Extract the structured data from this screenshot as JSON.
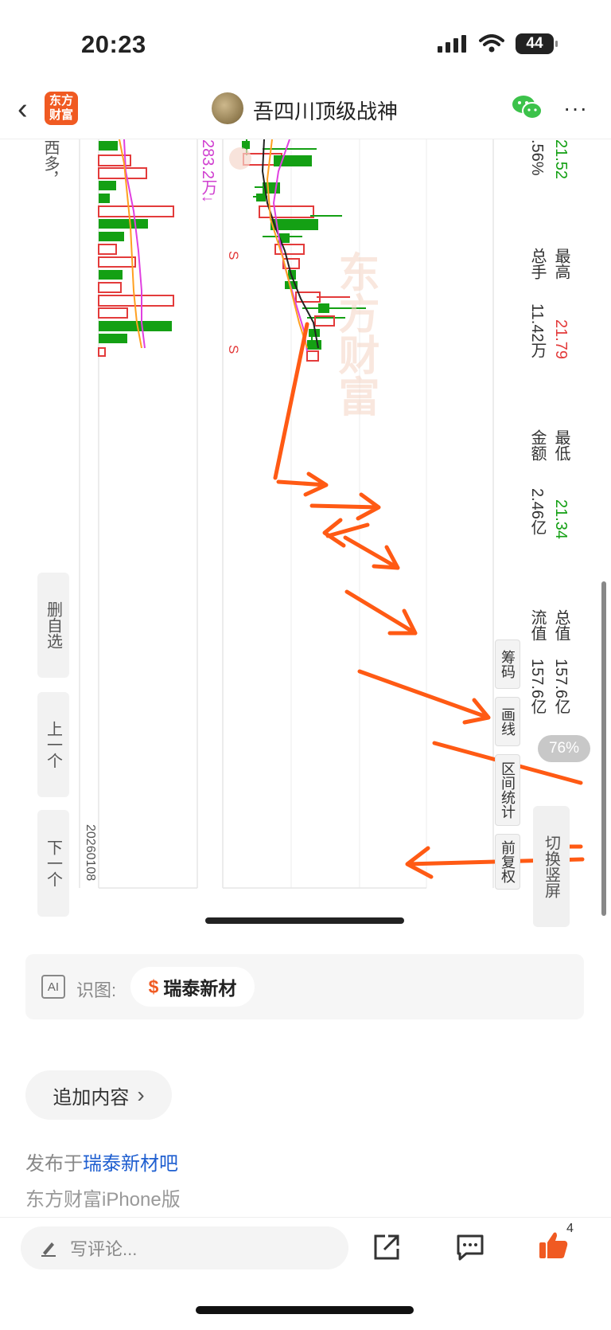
{
  "status_bar": {
    "time": "20:23",
    "battery": "44"
  },
  "nav": {
    "back_glyph": "‹",
    "logo_text_1": "东方",
    "logo_text_2": "财富",
    "title": "吾四川顶级战神",
    "more_glyph": "···"
  },
  "chart_view": {
    "left_text_top": "西多，",
    "volume_label": "283.2万↓",
    "date_label": "20260108",
    "watermark": "东方财富",
    "signals": [
      "S",
      "S"
    ],
    "quote": {
      "open_value": "21.52",
      "change_pct": ".56%",
      "high_label": "最高",
      "high_value": "21.79",
      "volume_label": "总手",
      "volume_value": "11.42万",
      "low_label": "最低",
      "low_value": "21.34",
      "amount_label": "金额",
      "amount_value": "2.46亿",
      "total_cap_label": "总值",
      "total_cap_value": "157.6亿",
      "float_cap_label": "流值",
      "float_cap_value": "157.6亿"
    },
    "side_buttons": [
      "删自选",
      "上一个",
      "下一个"
    ],
    "tool_buttons": [
      "筹码",
      "画线",
      "区间统计",
      "前复权"
    ],
    "switch_button": "切换竖屏",
    "zoom_pct": "76%"
  },
  "ai_recognition": {
    "label": "识图:",
    "icon_text": "AI",
    "stock_symbol": "$",
    "stock_name": "瑞泰新材"
  },
  "append_button": {
    "label": "追加内容",
    "arrow": "›"
  },
  "post_info": {
    "posted_prefix": "发布于",
    "forum_link": "瑞泰新材吧",
    "source": "东方财富iPhone版"
  },
  "bottom_bar": {
    "comment_placeholder": "写评论...",
    "like_count": "4"
  },
  "colors": {
    "brand": "#f05a22",
    "rise": "#e33b3b",
    "fall": "#14a014",
    "link": "#1f5fd0",
    "arrow": "#ff5a14"
  }
}
